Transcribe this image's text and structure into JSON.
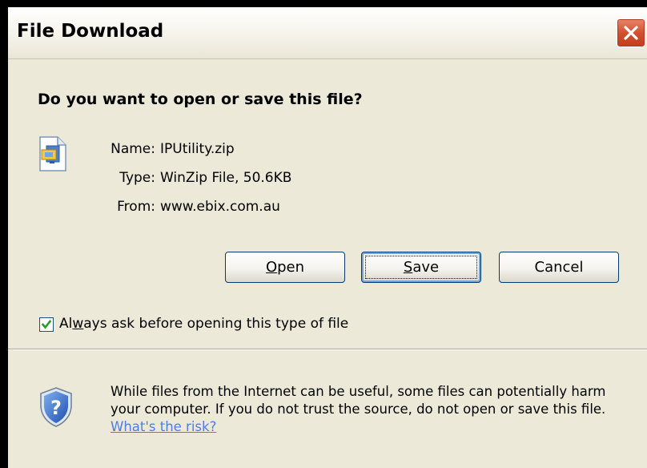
{
  "window": {
    "title": "File Download"
  },
  "dialog": {
    "question": "Do you want to open or save this file?",
    "file": {
      "name_label": "Name:",
      "name_value": "IPUtility.zip",
      "type_label": "Type:",
      "type_value": "WinZip File, 50.6KB",
      "from_label": "From:",
      "from_value": "www.ebix.com.au"
    },
    "buttons": {
      "open_pre": "",
      "open_mnemonic": "O",
      "open_post": "pen",
      "save_pre": "",
      "save_mnemonic": "S",
      "save_post": "ave",
      "cancel": "Cancel"
    },
    "always_ask": {
      "checked": true,
      "label_pre": "Al",
      "label_mnemonic": "w",
      "label_post": "ays ask before opening this type of file"
    },
    "warning": {
      "text": "While files from the Internet can be useful, some files can potentially harm your computer. If you do not trust the source, do not open or save this file.",
      "link": "What's the risk?"
    }
  },
  "colors": {
    "dialog_bg": "#ece9d8",
    "close_button": "#d3502e",
    "link": "#4d7de5",
    "button_border": "#003c74"
  },
  "icons": {
    "file": "zip-file-icon",
    "close": "close-icon",
    "shield": "security-shield-icon",
    "check": "checkmark-icon"
  }
}
